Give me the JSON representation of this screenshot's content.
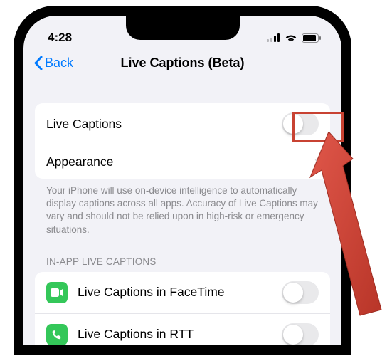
{
  "status": {
    "time": "4:28"
  },
  "nav": {
    "back_label": "Back",
    "title": "Live Captions (Beta)"
  },
  "main": {
    "rows": [
      {
        "label": "Live Captions",
        "toggle": false
      },
      {
        "label": "Appearance"
      }
    ],
    "footer": "Your iPhone will use on-device intelligence to automatically display captions across all apps. Accuracy of Live Captions may vary and should not be relied upon in high-risk or emergency situations."
  },
  "inapp": {
    "header": "IN-APP LIVE CAPTIONS",
    "rows": [
      {
        "label": "Live Captions in FaceTime",
        "toggle": false
      },
      {
        "label": "Live Captions in RTT",
        "toggle": false
      }
    ]
  }
}
